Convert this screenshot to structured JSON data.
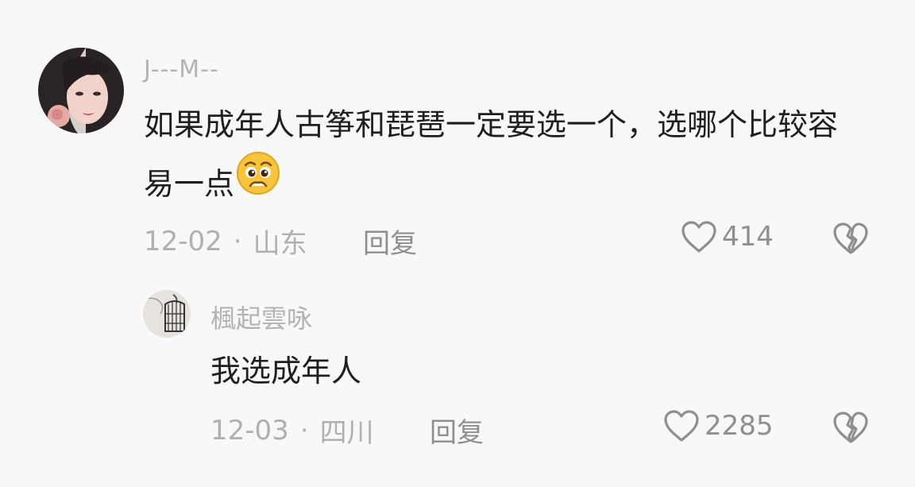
{
  "comments": [
    {
      "username": "J---M--",
      "text": "如果成年人古筝和琵琶一定要选一个，选哪个比较容易一点",
      "emoji": "pleading-face-emoji",
      "date": "12-02",
      "separator": "·",
      "location": "山东",
      "reply_label": "回复",
      "likes": "414"
    },
    {
      "username": "楓起雲咏",
      "text": "我选成年人",
      "date": "12-03",
      "separator": "·",
      "location": "四川",
      "reply_label": "回复",
      "likes": "2285"
    }
  ],
  "icons": {
    "like": "heart-outline-icon",
    "dislike": "broken-heart-icon"
  },
  "colors": {
    "background": "#f8f8f8",
    "text": "#1f1f1f",
    "muted": "#b0b0b0",
    "icon": "#8f8f8f",
    "emoji_face": "#f7c43a"
  }
}
